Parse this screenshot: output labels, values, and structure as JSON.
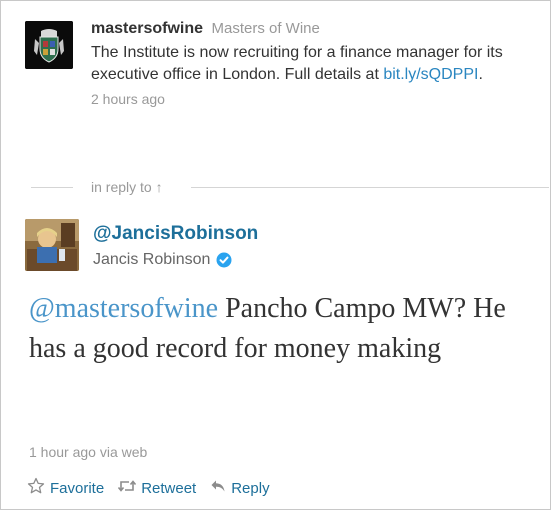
{
  "parent_tweet": {
    "screen_name": "mastersofwine",
    "display_name": "Masters of Wine",
    "text_before": "The Institute is now recruiting for a finance manager for its executive office in London. Full details at ",
    "link": "bit.ly/sQDPPI",
    "text_after": ".",
    "timestamp": "2 hours ago",
    "avatar_icon": "crest-icon"
  },
  "reply_divider": {
    "label": "in reply to ↑"
  },
  "main_tweet": {
    "screen_name": "@JancisRobinson",
    "display_name": "Jancis Robinson",
    "verified": true,
    "mention": "@mastersofwine",
    "text": " Pancho Campo MW? He has a good record for money making",
    "meta": "1 hour ago via web"
  },
  "actions": {
    "favorite": "Favorite",
    "retweet": "Retweet",
    "reply": "Reply"
  },
  "colors": {
    "link": "#2a86c0",
    "screen_name": "#1d6f9a",
    "muted": "#999999",
    "verified": "#2aa3ef"
  }
}
